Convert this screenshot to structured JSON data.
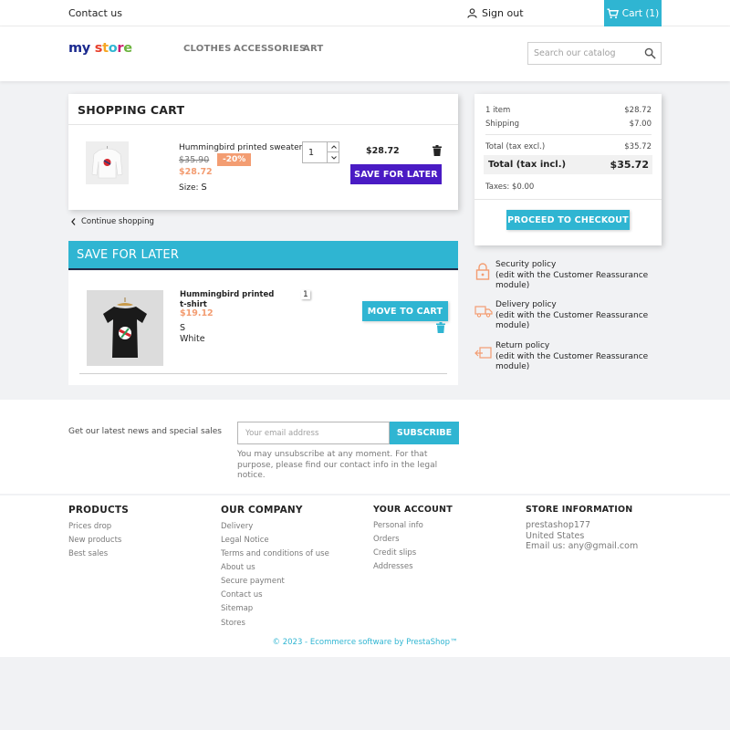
{
  "header": {
    "contact_label": "Contact us",
    "signin_label": "Sign out",
    "cart_label": "Cart (1)",
    "logo": {
      "part1": "my",
      "part2": "s",
      "part3": "t",
      "part4": "o",
      "part5": "r",
      "part6": "e"
    },
    "nav": [
      "CLOTHES",
      "ACCESSORIES",
      "ART"
    ],
    "search_placeholder": "Search our catalog"
  },
  "cart": {
    "title": "SHOPPING CART",
    "item": {
      "name": "Hummingbird printed sweater",
      "old_price": "$35.90",
      "discount": "-20%",
      "price": "$28.72",
      "size_label": "Size:",
      "size_value": "S",
      "quantity": "1",
      "total": "$28.72",
      "save_for_later": "SAVE FOR LATER"
    },
    "continue_label": "Continue shopping"
  },
  "save_for_later": {
    "title": "SAVE FOR LATER",
    "item": {
      "name": "Hummingbird printed t-shirt",
      "price": "$19.12",
      "size": "S",
      "color": "White",
      "quantity": "1",
      "move_to_cart": "MOVE TO CART"
    }
  },
  "summary": {
    "items_label": "1 item",
    "items_value": "$28.72",
    "shipping_label": "Shipping",
    "shipping_value": "$7.00",
    "total_excl_label": "Total (tax excl.)",
    "total_excl_value": "$35.72",
    "total_incl_label": "Total (tax incl.)",
    "total_incl_value": "$35.72",
    "taxes_label": "Taxes: $0.00",
    "checkout_label": "PROCEED TO CHECKOUT"
  },
  "reassurance": [
    {
      "title": "Security policy",
      "desc": "(edit with the Customer Reassurance module)"
    },
    {
      "title": "Delivery policy",
      "desc": "(edit with the Customer Reassurance module)"
    },
    {
      "title": "Return policy",
      "desc": "(edit with the Customer Reassurance module)"
    }
  ],
  "newsletter": {
    "label": "Get our latest news and special sales",
    "placeholder": "Your email address",
    "button": "SUBSCRIBE",
    "note": "You may unsubscribe at any moment. For that purpose, please find our contact info in the legal notice."
  },
  "footer": {
    "products": {
      "title": "PRODUCTS",
      "links": [
        "Prices drop",
        "New products",
        "Best sales"
      ]
    },
    "company": {
      "title": "OUR COMPANY",
      "links": [
        "Delivery",
        "Legal Notice",
        "Terms and conditions of use",
        "About us",
        "Secure payment",
        "Contact us",
        "Sitemap",
        "Stores"
      ]
    },
    "account": {
      "title": "YOUR ACCOUNT",
      "links": [
        "Personal info",
        "Orders",
        "Credit slips",
        "Addresses"
      ]
    },
    "store": {
      "title": "STORE INFORMATION",
      "lines": [
        "prestashop177",
        "United States",
        "Email us: any@gmail.com"
      ]
    },
    "copyright": "© 2023 - Ecommerce software by PrestaShop™"
  },
  "colors": {
    "accent": "#2fb5d2",
    "purple": "#4a1bc4",
    "sale": "#f39d72"
  }
}
